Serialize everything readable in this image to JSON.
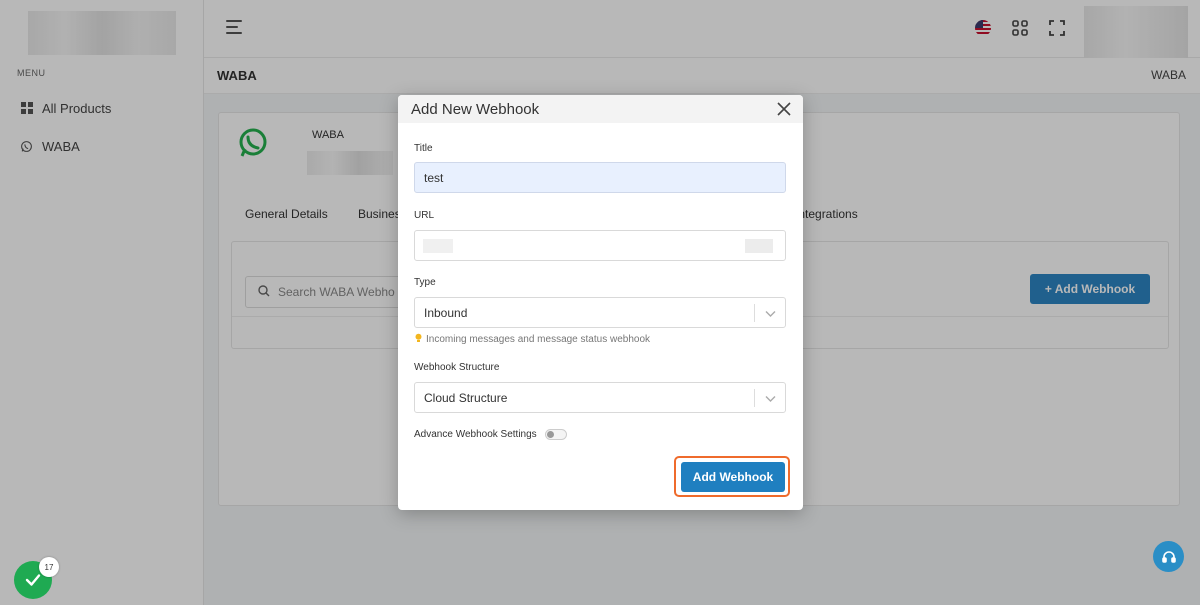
{
  "sidebar": {
    "menu_label": "MENU",
    "items": [
      {
        "label": "All Products",
        "icon": "grid-icon"
      },
      {
        "label": "WABA",
        "icon": "whatsapp-icon"
      }
    ]
  },
  "breadcrumb": {
    "title": "WABA",
    "right": "WABA"
  },
  "waba_card": {
    "name": "WABA",
    "tabs": [
      "General Details",
      "Busines",
      "Integrations"
    ],
    "search_placeholder": "Search WABA Webho",
    "add_button": "+ Add Webhook"
  },
  "modal": {
    "title": "Add New Webhook",
    "fields": {
      "title_label": "Title",
      "title_value": "test",
      "url_label": "URL",
      "type_label": "Type",
      "type_value": "Inbound",
      "type_hint": "Incoming messages and message status webhook",
      "structure_label": "Webhook Structure",
      "structure_value": "Cloud Structure",
      "advanced_label": "Advance Webhook Settings"
    },
    "submit_label": "Add Webhook"
  },
  "badges": {
    "task_count": "17"
  },
  "colors": {
    "primary": "#1f7fc0",
    "highlight": "#ef6b2c",
    "success": "#1faa52",
    "whatsapp": "#25b04e"
  }
}
